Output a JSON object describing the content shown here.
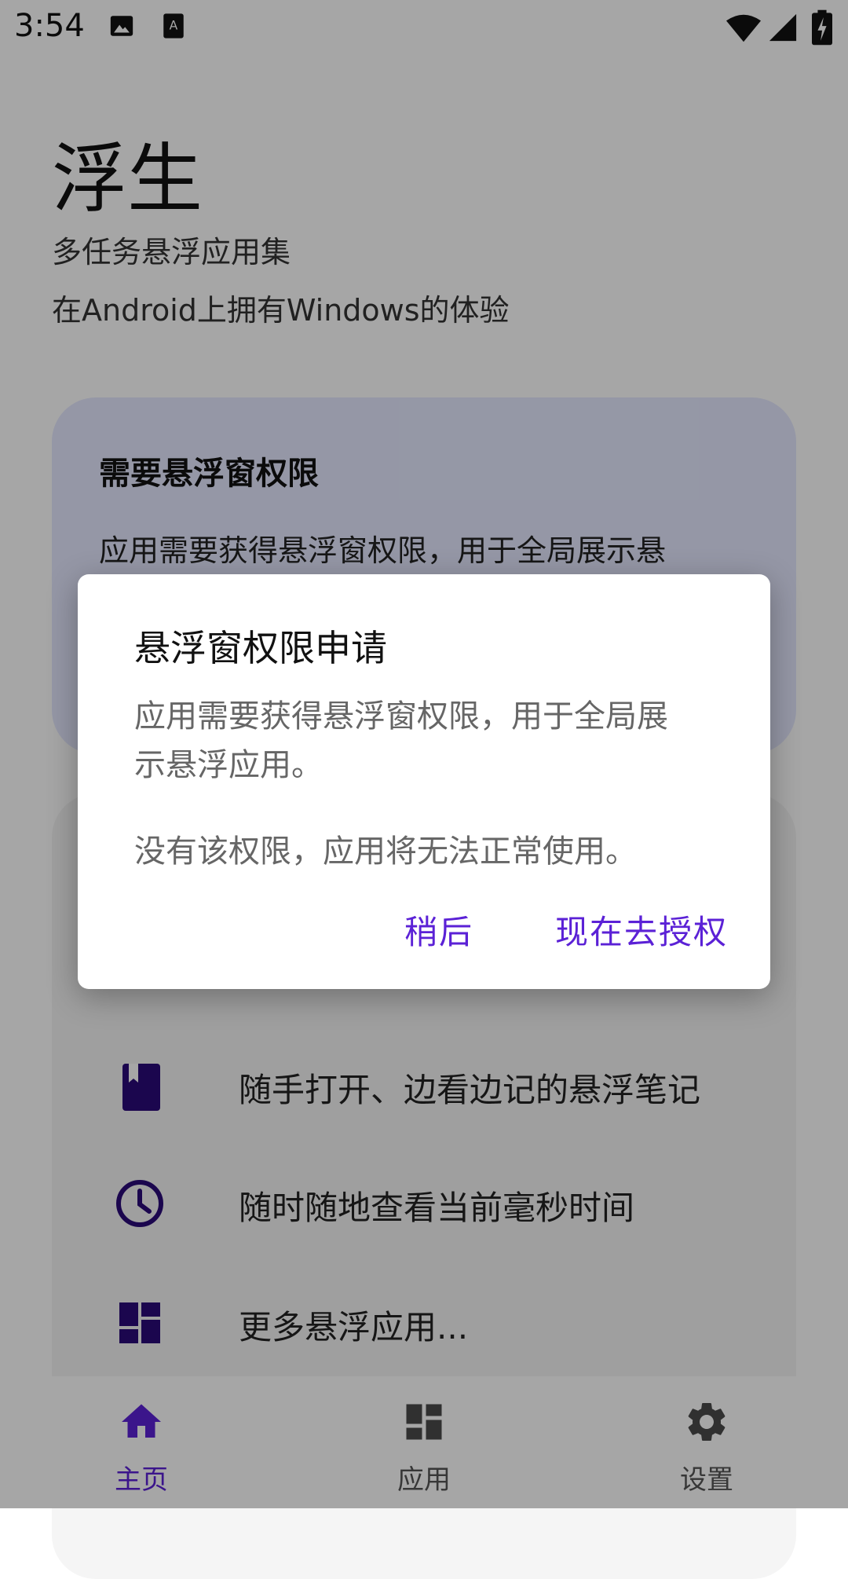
{
  "status_bar": {
    "time": "3:54",
    "icons": [
      "image-icon",
      "text-icon",
      "wifi-icon",
      "signal-icon",
      "battery-icon"
    ]
  },
  "app": {
    "title": "浮生",
    "subtitle1": "多任务悬浮应用集",
    "subtitle2": "在Android上拥有Windows的体验"
  },
  "permission_card": {
    "title": "需要悬浮窗权限",
    "text": "应用需要获得悬浮窗权限，用于全局展示悬"
  },
  "features": [
    {
      "icon": "book-icon",
      "label": "随手打开、边看边记的悬浮笔记"
    },
    {
      "icon": "clock-icon",
      "label": "随时随地查看当前毫秒时间"
    },
    {
      "icon": "dashboard-icon",
      "label": "更多悬浮应用..."
    }
  ],
  "bottom_nav": {
    "items": [
      {
        "label": "主页",
        "icon": "home-icon",
        "active": true
      },
      {
        "label": "应用",
        "icon": "dashboard-icon",
        "active": false
      },
      {
        "label": "设置",
        "icon": "gear-icon",
        "active": false
      }
    ]
  },
  "dialog": {
    "title": "悬浮窗权限申请",
    "body_line1": "应用需要获得悬浮窗权限，用于全局展",
    "body_line2": "示悬浮应用。",
    "body_line3": "没有该权限，应用将无法正常使用。",
    "later_label": "稍后",
    "grant_label": "现在去授权"
  },
  "colors": {
    "accent": "#5b21d6",
    "icon_dark": "#2a0a78",
    "perm_card_bg": "#e5e9ff"
  }
}
